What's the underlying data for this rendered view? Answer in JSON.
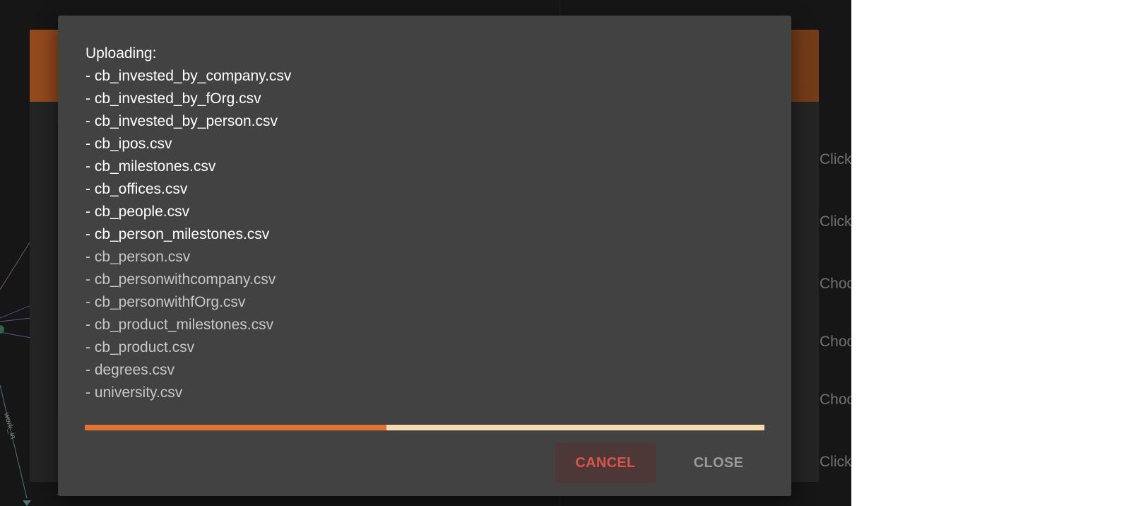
{
  "background": {
    "edge_label": "work_in",
    "side_hints": [
      "Click",
      "Click",
      "Choo",
      "Choo",
      "Choo",
      "Click"
    ]
  },
  "dialog": {
    "heading": "Uploading:",
    "files": [
      {
        "name": "- cb_invested_by_company.csv",
        "status": "done"
      },
      {
        "name": "- cb_invested_by_fOrg.csv",
        "status": "done"
      },
      {
        "name": "- cb_invested_by_person.csv",
        "status": "done"
      },
      {
        "name": "- cb_ipos.csv",
        "status": "done"
      },
      {
        "name": "- cb_milestones.csv",
        "status": "done"
      },
      {
        "name": "- cb_offices.csv",
        "status": "done"
      },
      {
        "name": "- cb_people.csv",
        "status": "done"
      },
      {
        "name": "- cb_person_milestones.csv",
        "status": "done"
      },
      {
        "name": "- cb_person.csv",
        "status": "pending"
      },
      {
        "name": "- cb_personwithcompany.csv",
        "status": "pending"
      },
      {
        "name": "- cb_personwithfOrg.csv",
        "status": "pending"
      },
      {
        "name": "- cb_product_milestones.csv",
        "status": "pending"
      },
      {
        "name": "- cb_product.csv",
        "status": "pending"
      },
      {
        "name": "- degrees.csv",
        "status": "pending"
      },
      {
        "name": "- university.csv",
        "status": "pending"
      }
    ],
    "progress": 0.444,
    "cancel_label": "CANCEL",
    "close_label": "CLOSE"
  },
  "colors": {
    "progress_fill": "#e07333",
    "progress_track": "#f6dbb3",
    "cancel_text": "#d9544a",
    "header_orange": "#b45b24"
  }
}
